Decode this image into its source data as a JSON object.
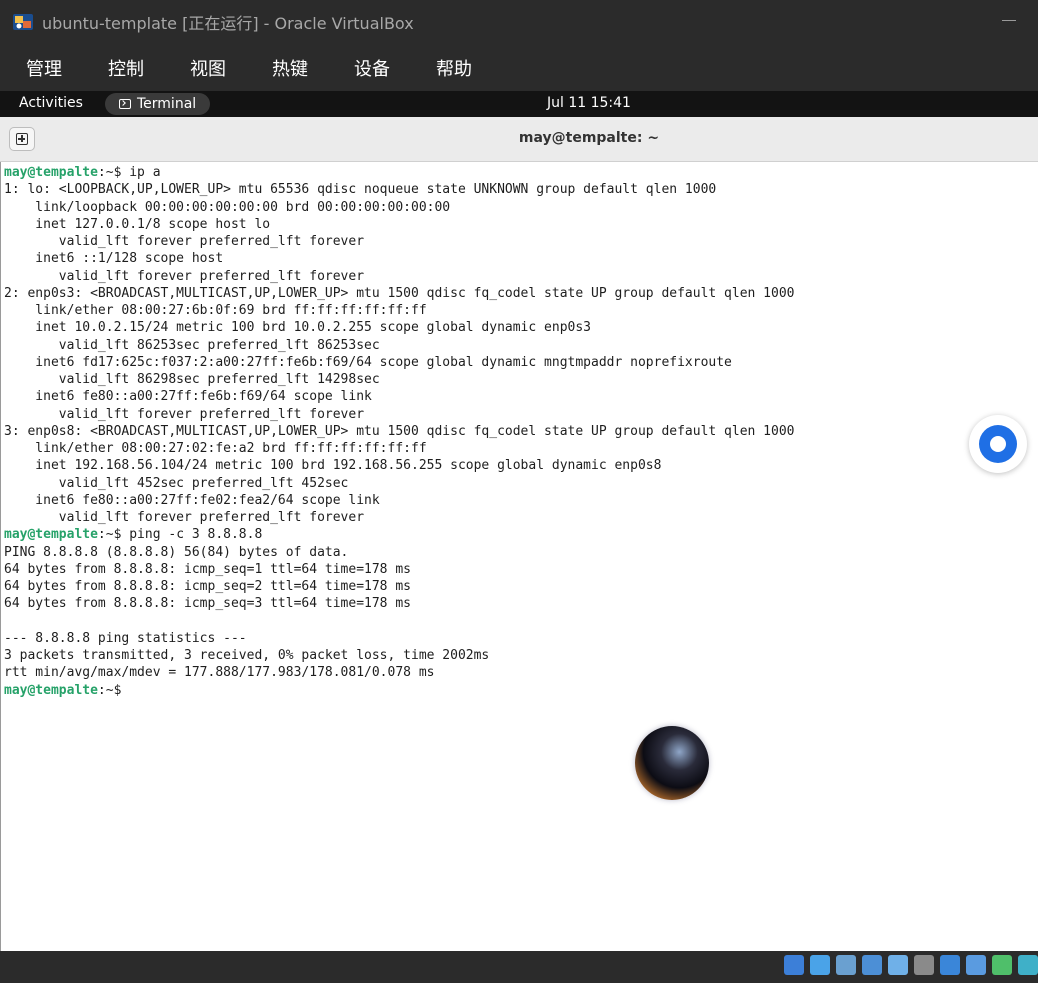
{
  "window": {
    "title": "ubuntu-template  [正在运行] - Oracle VirtualBox"
  },
  "menubar": {
    "items": [
      "管理",
      "控制",
      "视图",
      "热键",
      "设备",
      "帮助"
    ]
  },
  "topbar": {
    "activities": "Activities",
    "app_name": "Terminal",
    "clock": "Jul 11  15:41"
  },
  "terminal": {
    "title": "may@tempalte: ~",
    "prompt_user": "may@tempalte",
    "prompt_suffix": ":~$ ",
    "lines": [
      {
        "prompt": true,
        "text": "ip a"
      },
      {
        "prompt": false,
        "text": "1: lo: <LOOPBACK,UP,LOWER_UP> mtu 65536 qdisc noqueue state UNKNOWN group default qlen 1000"
      },
      {
        "prompt": false,
        "text": "    link/loopback 00:00:00:00:00:00 brd 00:00:00:00:00:00"
      },
      {
        "prompt": false,
        "text": "    inet 127.0.0.1/8 scope host lo"
      },
      {
        "prompt": false,
        "text": "       valid_lft forever preferred_lft forever"
      },
      {
        "prompt": false,
        "text": "    inet6 ::1/128 scope host"
      },
      {
        "prompt": false,
        "text": "       valid_lft forever preferred_lft forever"
      },
      {
        "prompt": false,
        "text": "2: enp0s3: <BROADCAST,MULTICAST,UP,LOWER_UP> mtu 1500 qdisc fq_codel state UP group default qlen 1000"
      },
      {
        "prompt": false,
        "text": "    link/ether 08:00:27:6b:0f:69 brd ff:ff:ff:ff:ff:ff"
      },
      {
        "prompt": false,
        "text": "    inet 10.0.2.15/24 metric 100 brd 10.0.2.255 scope global dynamic enp0s3"
      },
      {
        "prompt": false,
        "text": "       valid_lft 86253sec preferred_lft 86253sec"
      },
      {
        "prompt": false,
        "text": "    inet6 fd17:625c:f037:2:a00:27ff:fe6b:f69/64 scope global dynamic mngtmpaddr noprefixroute"
      },
      {
        "prompt": false,
        "text": "       valid_lft 86298sec preferred_lft 14298sec"
      },
      {
        "prompt": false,
        "text": "    inet6 fe80::a00:27ff:fe6b:f69/64 scope link"
      },
      {
        "prompt": false,
        "text": "       valid_lft forever preferred_lft forever"
      },
      {
        "prompt": false,
        "text": "3: enp0s8: <BROADCAST,MULTICAST,UP,LOWER_UP> mtu 1500 qdisc fq_codel state UP group default qlen 1000"
      },
      {
        "prompt": false,
        "text": "    link/ether 08:00:27:02:fe:a2 brd ff:ff:ff:ff:ff:ff"
      },
      {
        "prompt": false,
        "text": "    inet 192.168.56.104/24 metric 100 brd 192.168.56.255 scope global dynamic enp0s8"
      },
      {
        "prompt": false,
        "text": "       valid_lft 452sec preferred_lft 452sec"
      },
      {
        "prompt": false,
        "text": "    inet6 fe80::a00:27ff:fe02:fea2/64 scope link"
      },
      {
        "prompt": false,
        "text": "       valid_lft forever preferred_lft forever"
      },
      {
        "prompt": true,
        "text": "ping -c 3 8.8.8.8"
      },
      {
        "prompt": false,
        "text": "PING 8.8.8.8 (8.8.8.8) 56(84) bytes of data."
      },
      {
        "prompt": false,
        "text": "64 bytes from 8.8.8.8: icmp_seq=1 ttl=64 time=178 ms"
      },
      {
        "prompt": false,
        "text": "64 bytes from 8.8.8.8: icmp_seq=2 ttl=64 time=178 ms"
      },
      {
        "prompt": false,
        "text": "64 bytes from 8.8.8.8: icmp_seq=3 ttl=64 time=178 ms"
      },
      {
        "prompt": false,
        "text": ""
      },
      {
        "prompt": false,
        "text": "--- 8.8.8.8 ping statistics ---"
      },
      {
        "prompt": false,
        "text": "3 packets transmitted, 3 received, 0% packet loss, time 2002ms"
      },
      {
        "prompt": false,
        "text": "rtt min/avg/max/mdev = 177.888/177.983/178.081/0.078 ms"
      },
      {
        "prompt": true,
        "text": ""
      }
    ]
  },
  "statusbar": {
    "icons": [
      {
        "name": "hard-disk-icon",
        "color": "#3c7fd8"
      },
      {
        "name": "optical-drive-icon",
        "color": "#4aa3e8"
      },
      {
        "name": "audio-icon",
        "color": "#6aa0d0"
      },
      {
        "name": "network-icon",
        "color": "#4c8fd6"
      },
      {
        "name": "usb-icon",
        "color": "#6fb0e8"
      },
      {
        "name": "shared-folders-icon",
        "color": "#8a8a8a"
      },
      {
        "name": "display-icon",
        "color": "#3a86d9"
      },
      {
        "name": "video-capture-icon",
        "color": "#5a9be0"
      },
      {
        "name": "cpu-icon",
        "color": "#4fbf6a"
      },
      {
        "name": "mouse-integration-icon",
        "color": "#3fb0c8"
      }
    ]
  },
  "colors": {
    "prompt_green": "#26a269",
    "vbox_chrome": "#2b2b2b",
    "gnome_bar": "#131313",
    "terminal_bg": "#ffffff"
  }
}
